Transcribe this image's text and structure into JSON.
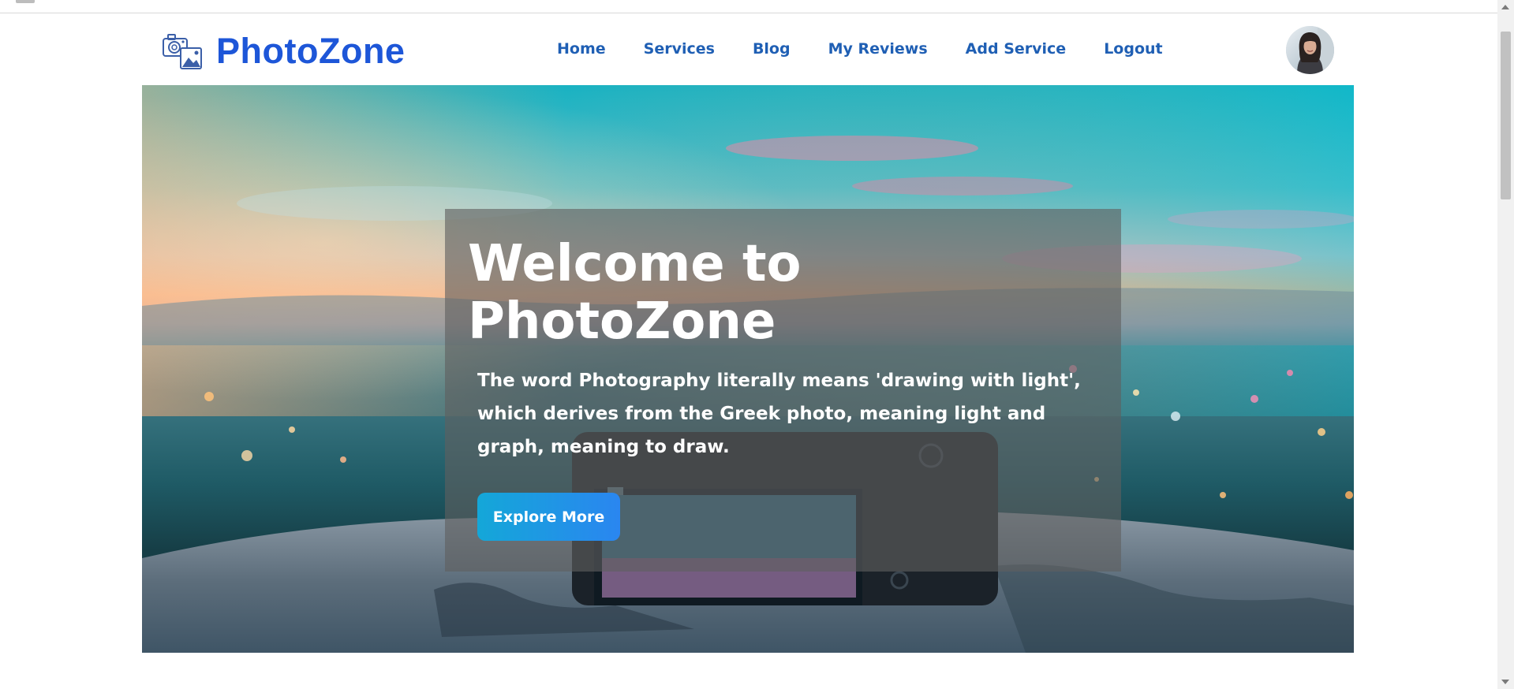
{
  "brand": {
    "name": "PhotoZone"
  },
  "nav": {
    "items": [
      {
        "label": "Home"
      },
      {
        "label": "Services"
      },
      {
        "label": "Blog"
      },
      {
        "label": "My Reviews"
      },
      {
        "label": "Add Service"
      },
      {
        "label": "Logout"
      }
    ]
  },
  "hero": {
    "title": "Welcome to PhotoZone",
    "text": "The word Photography literally means 'drawing with light', which derives from the Greek photo, meaning light and graph, meaning to draw.",
    "button_label": "Explore More"
  },
  "colors": {
    "brand": "#1d56d8",
    "nav_link": "#1f5fb4",
    "button_start": "#14a7d8",
    "button_end": "#2a86f0"
  },
  "icons": {
    "brand_icon": "camera-photo-icon",
    "avatar": "user-avatar"
  }
}
